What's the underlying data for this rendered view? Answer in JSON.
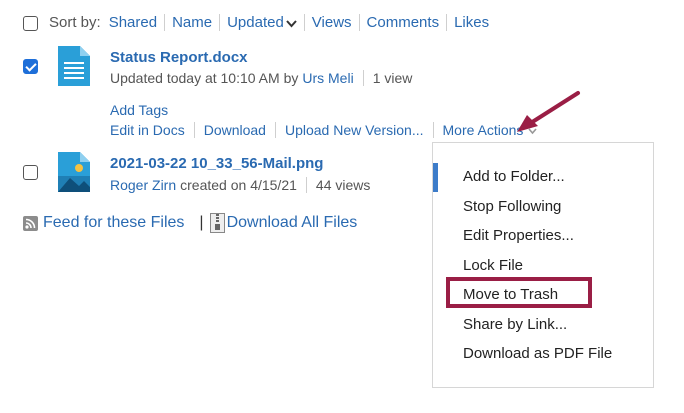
{
  "sort": {
    "label": "Sort by:",
    "options": [
      "Shared",
      "Name",
      "Updated",
      "Views",
      "Comments",
      "Likes"
    ]
  },
  "files": [
    {
      "name": "Status Report.docx",
      "meta_prefix": "Updated today at 10:10 AM by",
      "author": "Urs Meli",
      "views": "1 view",
      "selected": true,
      "icon": "document-icon"
    },
    {
      "name": "2021-03-22 10_33_56-Mail.png",
      "author": "Roger Zirn",
      "meta_suffix": "created on 4/15/21",
      "views": "44 views",
      "selected": false,
      "icon": "image-icon"
    }
  ],
  "file_actions": {
    "add_tags": "Add Tags",
    "edit_in_docs": "Edit in Docs",
    "download": "Download",
    "upload_new_version": "Upload New Version...",
    "more_actions": "More Actions"
  },
  "more_actions_menu": [
    "Add to Folder...",
    "Stop Following",
    "Edit Properties...",
    "Lock File",
    "Move to Trash",
    "Share by Link...",
    "Download as PDF File"
  ],
  "footer": {
    "feed": "Feed for these Files",
    "download_all": "Download All Files"
  },
  "colors": {
    "link": "#2a6ab1",
    "checkbox_checked": "#1e6fd9",
    "annotation": "#9a1e45",
    "file_icon": "#2a9fd8"
  }
}
